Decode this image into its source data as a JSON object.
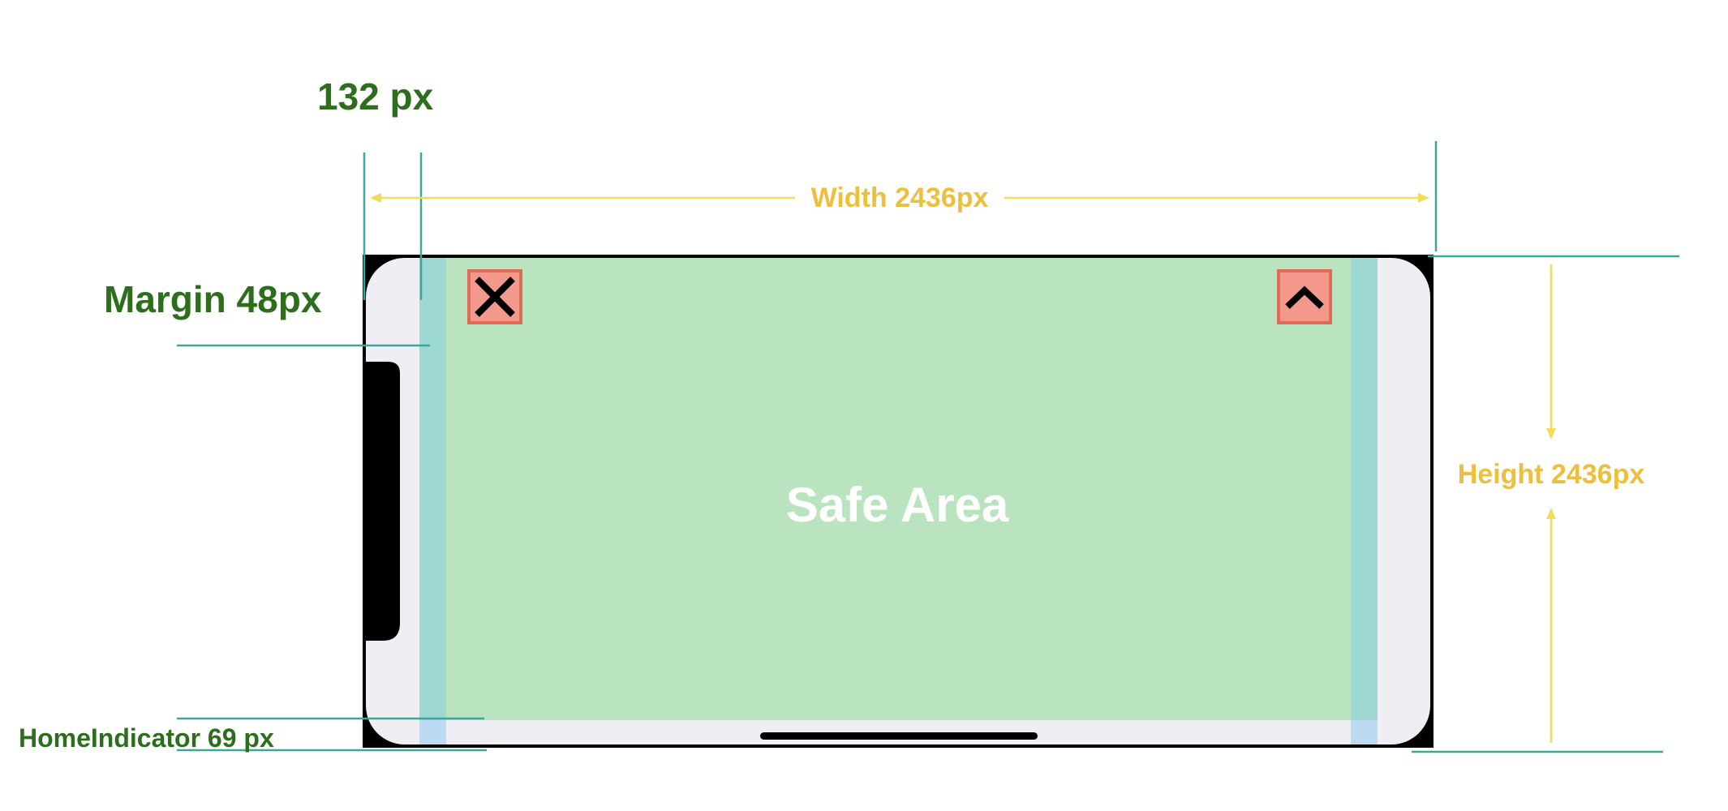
{
  "labels": {
    "notch_width": "132 px",
    "margin": "Margin 48px",
    "home_indicator": "HomeIndicator 69 px",
    "width": "Width 2436px",
    "height": "Height 2436px",
    "safe_area": "Safe Area"
  },
  "icons": {
    "close": "close-icon",
    "chevron": "chevron-up-icon"
  },
  "colors": {
    "device_frame": "#000000",
    "screen": "#efeef3",
    "safe_area": "#bae4c0",
    "margin_strip": "#9dd8d3",
    "home_strip": "#bcdaf2",
    "button_fill": "#f2998b",
    "button_border": "#e06a55",
    "guide_teal": "#3aa79a",
    "dimension_yellow": "#f2dc5a",
    "label_green": "#2d6e1c",
    "label_yellow": "#ecc03c"
  }
}
